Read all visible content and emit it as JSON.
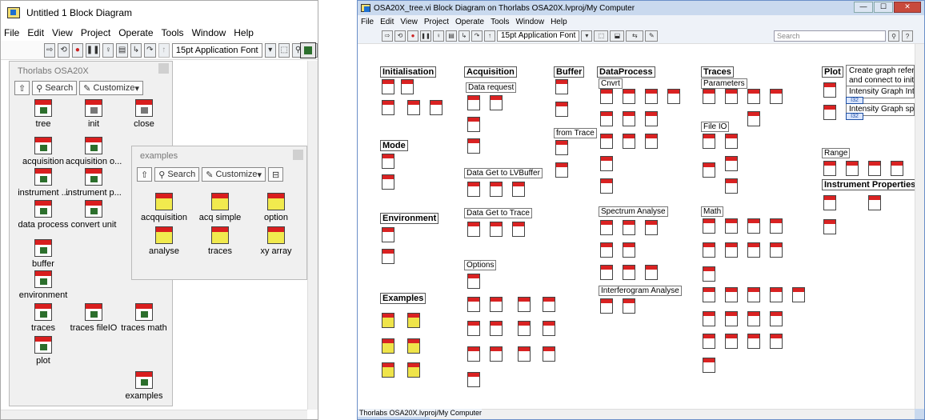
{
  "left_window": {
    "title": "Untitled 1 Block Diagram",
    "menu": [
      "File",
      "Edit",
      "View",
      "Project",
      "Operate",
      "Tools",
      "Window",
      "Help"
    ],
    "font_label": "15pt Application Font",
    "palette": {
      "title": "Thorlabs OSA20X",
      "search_label": "Search",
      "customize_label": "Customize",
      "items": [
        "tree",
        "init",
        "close",
        "acquisition",
        "acquisition o...",
        "instrument ...",
        "instrument p...",
        "data process",
        "convert unit",
        "buffer",
        "environment",
        "traces",
        "traces fileIO",
        "traces math",
        "plot",
        "examples"
      ]
    },
    "sub_palette": {
      "title": "examples",
      "search_label": "Search",
      "customize_label": "Customize",
      "items": [
        "acqquisition",
        "acq simple",
        "option",
        "analyse",
        "traces",
        "xy array"
      ]
    }
  },
  "right_window": {
    "title": "OSA20X_tree.vi Block Diagram on Thorlabs OSA20X.lvproj/My Computer",
    "menu": [
      "File",
      "Edit",
      "View",
      "Project",
      "Operate",
      "Tools",
      "Window",
      "Help"
    ],
    "font_label": "15pt Application Font",
    "search_placeholder": "Search",
    "status_text": "Thorlabs OSA20X.lvproj/My Computer",
    "headings": [
      "Initialisation",
      "Acquisition",
      "Buffer",
      "DataProcess",
      "Traces",
      "Plot",
      "Mode",
      "Environment",
      "Examples",
      "Instrument Properties"
    ],
    "subheadings": [
      "Cnvrt",
      "Parameters",
      "Data request",
      "from Trace",
      "File IO",
      "Data Get to LVBuffer",
      "Data Get to Trace",
      "Spectrum Analyse",
      "Math",
      "Options",
      "Interferogram Analyse",
      "Range"
    ],
    "plot_notes": [
      "Create graph references",
      "and connect to init routines.",
      "Intensity Graph Interferogram",
      "Intensity Graph spectrum"
    ],
    "tag_label": "I32"
  }
}
